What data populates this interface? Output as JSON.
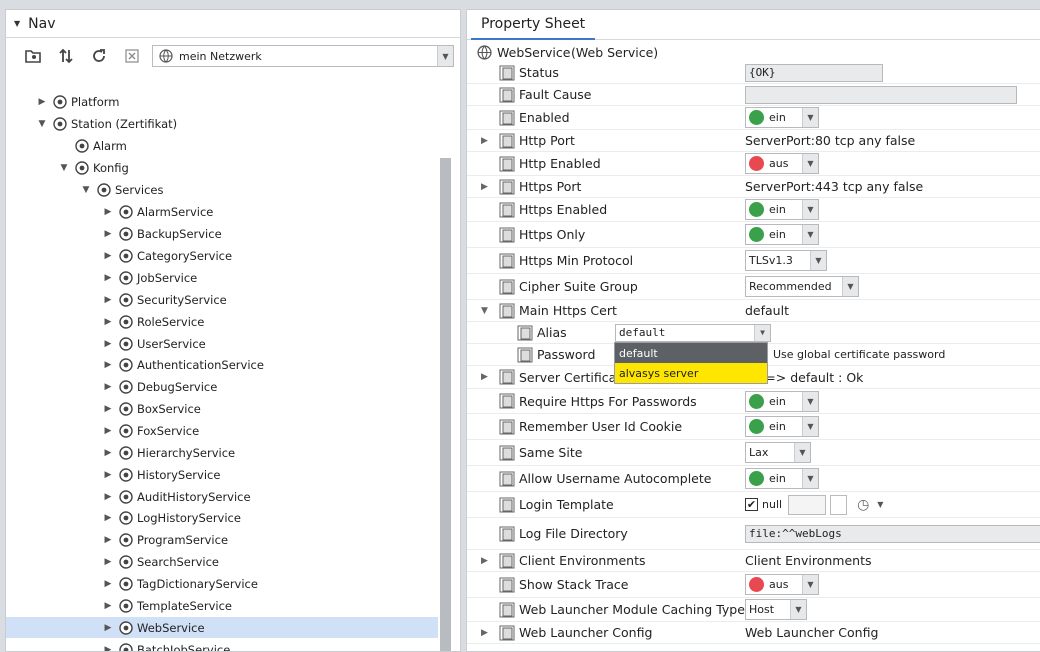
{
  "nav": {
    "title": "Nav",
    "network": "mein Netzwerk",
    "tree": [
      {
        "label": "Platform",
        "icon": "platform-icon",
        "indent": 0,
        "exp": "right"
      },
      {
        "label": "Station (Zertifikat)",
        "icon": "station-icon",
        "indent": 0,
        "exp": "down"
      },
      {
        "label": "Alarm",
        "icon": "bell-icon",
        "indent": 1,
        "exp": ""
      },
      {
        "label": "Konfig",
        "icon": "database-icon",
        "indent": 1,
        "exp": "down"
      },
      {
        "label": "Services",
        "icon": "services-icon",
        "indent": 2,
        "exp": "down"
      },
      {
        "label": "AlarmService",
        "icon": "alarm-service-icon",
        "indent": 3,
        "exp": "right"
      },
      {
        "label": "BackupService",
        "icon": "backup-service-icon",
        "indent": 3,
        "exp": "right"
      },
      {
        "label": "CategoryService",
        "icon": "category-service-icon",
        "indent": 3,
        "exp": "right"
      },
      {
        "label": "JobService",
        "icon": "job-service-icon",
        "indent": 3,
        "exp": "right"
      },
      {
        "label": "SecurityService",
        "icon": "shield-icon",
        "indent": 3,
        "exp": "right"
      },
      {
        "label": "RoleService",
        "icon": "role-service-icon",
        "indent": 3,
        "exp": "right"
      },
      {
        "label": "UserService",
        "icon": "user-service-icon",
        "indent": 3,
        "exp": "right"
      },
      {
        "label": "AuthenticationService",
        "icon": "lock-icon",
        "indent": 3,
        "exp": "right"
      },
      {
        "label": "DebugService",
        "icon": "debug-icon",
        "indent": 3,
        "exp": "right"
      },
      {
        "label": "BoxService",
        "icon": "box-icon",
        "indent": 3,
        "exp": "right"
      },
      {
        "label": "FoxService",
        "icon": "fox-icon",
        "indent": 3,
        "exp": "right"
      },
      {
        "label": "HierarchyService",
        "icon": "hierarchy-icon",
        "indent": 3,
        "exp": "right"
      },
      {
        "label": "HistoryService",
        "icon": "history-icon",
        "indent": 3,
        "exp": "right"
      },
      {
        "label": "AuditHistoryService",
        "icon": "audit-icon",
        "indent": 3,
        "exp": "right"
      },
      {
        "label": "LogHistoryService",
        "icon": "log-icon",
        "indent": 3,
        "exp": "right"
      },
      {
        "label": "ProgramService",
        "icon": "program-icon",
        "indent": 3,
        "exp": "right"
      },
      {
        "label": "SearchService",
        "icon": "search-icon",
        "indent": 3,
        "exp": "right"
      },
      {
        "label": "TagDictionaryService",
        "icon": "tag-icon",
        "indent": 3,
        "exp": "right"
      },
      {
        "label": "TemplateService",
        "icon": "template-icon",
        "indent": 3,
        "exp": "right"
      },
      {
        "label": "WebService",
        "icon": "globe-icon",
        "indent": 3,
        "exp": "right",
        "selected": true
      },
      {
        "label": "BatchJobService",
        "icon": "batch-icon",
        "indent": 3,
        "exp": "right"
      }
    ]
  },
  "ps": {
    "tab": "Property Sheet",
    "root_name": "WebService",
    "root_type": "(Web Service)",
    "rows": [
      {
        "label": "Status",
        "kind": "field",
        "value": "{OK}",
        "w": 138
      },
      {
        "label": "Fault Cause",
        "kind": "field",
        "value": "",
        "w": 272
      },
      {
        "label": "Enabled",
        "kind": "bool",
        "value": "ein",
        "state": "green"
      },
      {
        "label": "Http Port",
        "kind": "text",
        "value": "ServerPort:80 tcp any false",
        "exp": true
      },
      {
        "label": "Http Enabled",
        "kind": "bool",
        "value": "aus",
        "state": "red"
      },
      {
        "label": "Https Port",
        "kind": "text",
        "value": "ServerPort:443 tcp any false",
        "exp": true
      },
      {
        "label": "Https Enabled",
        "kind": "bool",
        "value": "ein",
        "state": "green"
      },
      {
        "label": "Https Only",
        "kind": "bool",
        "value": "ein",
        "state": "green"
      },
      {
        "label": "Https Min Protocol",
        "kind": "combo",
        "value": "TLSv1.3",
        "w": 82
      },
      {
        "label": "Cipher Suite Group",
        "kind": "combo",
        "value": "Recommended",
        "w": 114
      },
      {
        "label": "Main Https Cert",
        "kind": "text",
        "value": "default",
        "exp": "down"
      },
      {
        "label": "Alias",
        "kind": "alias",
        "value": "default",
        "sub": true
      },
      {
        "label": "Password",
        "kind": "text2",
        "value": "Use global certificate password",
        "sub": true
      },
      {
        "label": "Server Certificate",
        "kind": "text",
        "value": "ult => default : Ok",
        "exp": true
      },
      {
        "label": "Require Https For Passwords",
        "kind": "bool",
        "value": "ein",
        "state": "green"
      },
      {
        "label": "Remember User Id Cookie",
        "kind": "bool",
        "value": "ein",
        "state": "green"
      },
      {
        "label": "Same Site",
        "kind": "combo",
        "value": "Lax",
        "w": 66
      },
      {
        "label": "Allow Username Autocomplete",
        "kind": "bool",
        "value": "ein",
        "state": "green"
      },
      {
        "label": "Login Template",
        "kind": "null",
        "value": "null"
      },
      {
        "label": "Log File Directory",
        "kind": "field",
        "value": "file:^^webLogs",
        "w": 300
      },
      {
        "label": "Client Environments",
        "kind": "text",
        "value": "Client Environments",
        "exp": true
      },
      {
        "label": "Show Stack Trace",
        "kind": "bool",
        "value": "aus",
        "state": "red"
      },
      {
        "label": "Web Launcher Module Caching Type",
        "kind": "combo",
        "value": "Host",
        "w": 62
      },
      {
        "label": "Web Launcher Config",
        "kind": "text",
        "value": "Web Launcher Config",
        "exp": true
      }
    ],
    "alias_options": [
      "default",
      "alvasys server"
    ]
  },
  "colors": {
    "green": "#3aa04a",
    "red": "#e8484f",
    "accent": "#3b78c9"
  }
}
